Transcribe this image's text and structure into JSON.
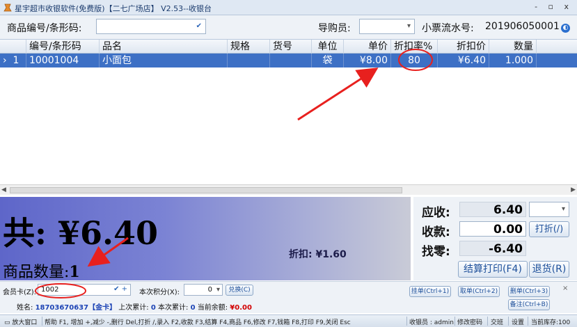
{
  "window": {
    "title": "星宇超市收银软件(免费版)【二七广场店】 V2.53--收银台",
    "controls": "- ▫ x"
  },
  "query": {
    "code_label": "商品编号/条形码:",
    "code_value": "",
    "guide_label": "导购员:",
    "guide_value": "",
    "serial_label": "小票流水号:",
    "serial_value": "201906050001"
  },
  "grid": {
    "columns": [
      "编号/条形码",
      "品名",
      "规格",
      "货号",
      "单位",
      "单价",
      "折扣率%",
      "折扣价",
      "数量"
    ],
    "rows": [
      {
        "index": "1",
        "code": "10001004",
        "name": "小面包",
        "spec": "",
        "sku": "",
        "unit": "袋",
        "price": "¥8.00",
        "rate": "80",
        "disc_price": "¥6.40",
        "qty": "1.000"
      }
    ]
  },
  "summary": {
    "total": "共: ¥6.40",
    "discount": "折扣: ¥1.60",
    "qty_label": "商品数量:",
    "qty_value": "1"
  },
  "payment": {
    "receivable_label": "应收:",
    "receivable": "6.40",
    "received_label": "收款:",
    "received": "0.00",
    "change_label": "找零:",
    "change": "-6.40",
    "discount_btn": "打折(/)",
    "settle_btn": "结算打印(F4)",
    "refund_btn": "退货(R)"
  },
  "member": {
    "card_label": "会员卡(Z):",
    "card_value": "1002",
    "points_label": "本次积分(X):",
    "points_value": "0",
    "redeem_btn": "兑换(C)",
    "name_label": "姓名:",
    "name_value": "18703670637【金卡】",
    "last_total_label": "上次累计:",
    "last_total": "0",
    "this_total_label": "本次累计:",
    "this_total": "0",
    "balance_label": "当前余额:",
    "balance": "¥0.00"
  },
  "actions": {
    "hold_btn": "挂单(Ctrl+1)",
    "pick_btn": "取单(Ctrl+2)",
    "delete_btn": "删单(Ctrl+3)",
    "note_btn": "备注(Ctrl+B)"
  },
  "status": {
    "expand": "放大窗口",
    "help": "帮助 F1, 增加 +,减少 -,删行 Del,打折 /,录入 F2,收款 F3,结算 F4,商品 F6,修改 F7,钱箱 F8,打印 F9,关闭 Esc",
    "cashier": "收银员 : admin",
    "change_pwd": "修改密码",
    "shift": "交班",
    "settings": "设置",
    "stock": "当前库存:100"
  },
  "icons": {
    "app": "app-icon",
    "dropdown": "chevron-down-icon",
    "help": "help-icon"
  },
  "colors": {
    "selected_row": "#3d70c5",
    "annotation": "#e8201e",
    "total_panel_start": "#5e66c9"
  }
}
